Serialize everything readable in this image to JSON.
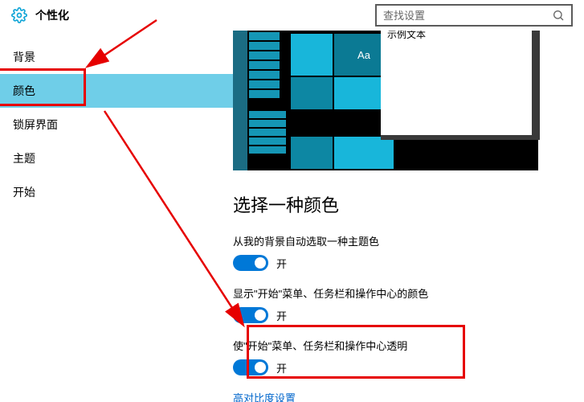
{
  "header": {
    "title": "个性化",
    "search_placeholder": "查找设置"
  },
  "sidebar": {
    "items": [
      {
        "label": "背景"
      },
      {
        "label": "颜色"
      },
      {
        "label": "锁屏界面"
      },
      {
        "label": "主题"
      },
      {
        "label": "开始"
      }
    ],
    "selected_index": 1
  },
  "preview": {
    "sample_text": "示例文本",
    "aa": "Aa"
  },
  "main": {
    "section_title": "选择一种颜色",
    "settings": [
      {
        "label": "从我的背景自动选取一种主题色",
        "state": "开",
        "on": true
      },
      {
        "label": "显示\"开始\"菜单、任务栏和操作中心的颜色",
        "state": "开",
        "on": true
      },
      {
        "label": "使\"开始\"菜单、任务栏和操作中心透明",
        "state": "开",
        "on": true
      }
    ],
    "link": "高对比度设置"
  }
}
